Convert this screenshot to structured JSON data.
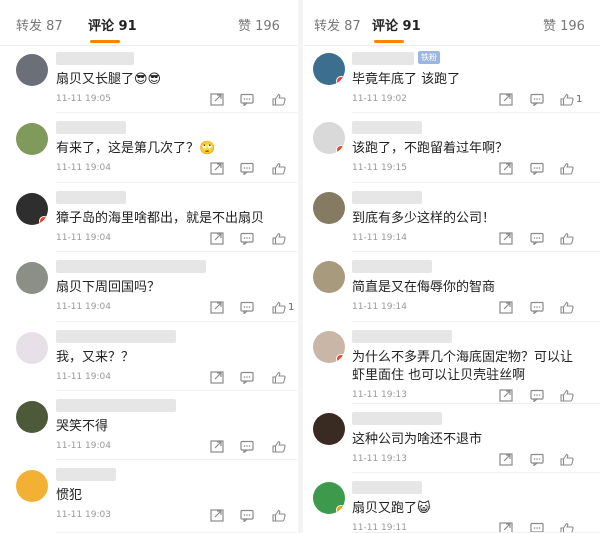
{
  "tabs": {
    "reposts": "转发 87",
    "comments": "评论 91",
    "likes": "赞 196"
  },
  "left": [
    {
      "text": "扇贝又长腿了😎😎",
      "time": "11-11 19:05",
      "avatar": "#6b6f78",
      "badge": null,
      "like_count": ""
    },
    {
      "text": "有来了，这是第几次了？🙄",
      "time": "11-11 19:04",
      "avatar": "#7f9a5a",
      "badge": null,
      "like_count": ""
    },
    {
      "text": "獐子岛的海里啥都出，就是不出扇贝",
      "time": "11-11 19:04",
      "avatar": "#2e2e2e",
      "badge": "#e8452c",
      "like_count": ""
    },
    {
      "text": "扇贝下周回国吗？",
      "time": "11-11 19:04",
      "avatar": "#8b8f86",
      "badge": null,
      "like_count": "1"
    },
    {
      "text": "我，又来？？",
      "time": "11-11 19:04",
      "avatar": "#e8e0e8",
      "badge": null,
      "like_count": ""
    },
    {
      "text": "哭笑不得",
      "time": "11-11 19:04",
      "avatar": "#4d5a3a",
      "badge": null,
      "like_count": ""
    },
    {
      "text": "惯犯",
      "time": "11-11 19:03",
      "avatar": "#f2b134",
      "badge": null,
      "like_count": ""
    }
  ],
  "right": [
    {
      "text": "毕竟年底了 该跑了",
      "time": "11-11 19:02",
      "avatar": "#3c6e8f",
      "badge": "#e8452c",
      "like_count": "1"
    },
    {
      "text": "该跑了，不跑留着过年啊？",
      "time": "11-11 19:15",
      "avatar": "#d9d9d9",
      "badge": "#e8452c",
      "like_count": ""
    },
    {
      "text": "到底有多少这样的公司！",
      "time": "11-11 19:14",
      "avatar": "#857a62",
      "badge": null,
      "like_count": ""
    },
    {
      "text": "简直是又在侮辱你的智商",
      "time": "11-11 19:14",
      "avatar": "#a89a7c",
      "badge": null,
      "like_count": ""
    },
    {
      "text": "为什么不多弄几个海底固定物？可以让",
      "text2": "虾里面住  也可以让贝壳驻丝啊",
      "time": "11-11 19:13",
      "avatar": "#c9b6a7",
      "badge": "#e8452c",
      "like_count": ""
    },
    {
      "text": "这种公司为啥还不退市",
      "time": "11-11 19:13",
      "avatar": "#3a2b22",
      "badge": null,
      "like_count": ""
    },
    {
      "text": "扇贝又跑了😺",
      "time": "11-11 19:11",
      "avatar": "#3d9a4d",
      "badge": "#f0a400",
      "like_count": ""
    }
  ],
  "right_badge_label": "铁粉",
  "colors": {
    "accent": "#ff8200",
    "text": "#222222",
    "muted": "#999999"
  }
}
